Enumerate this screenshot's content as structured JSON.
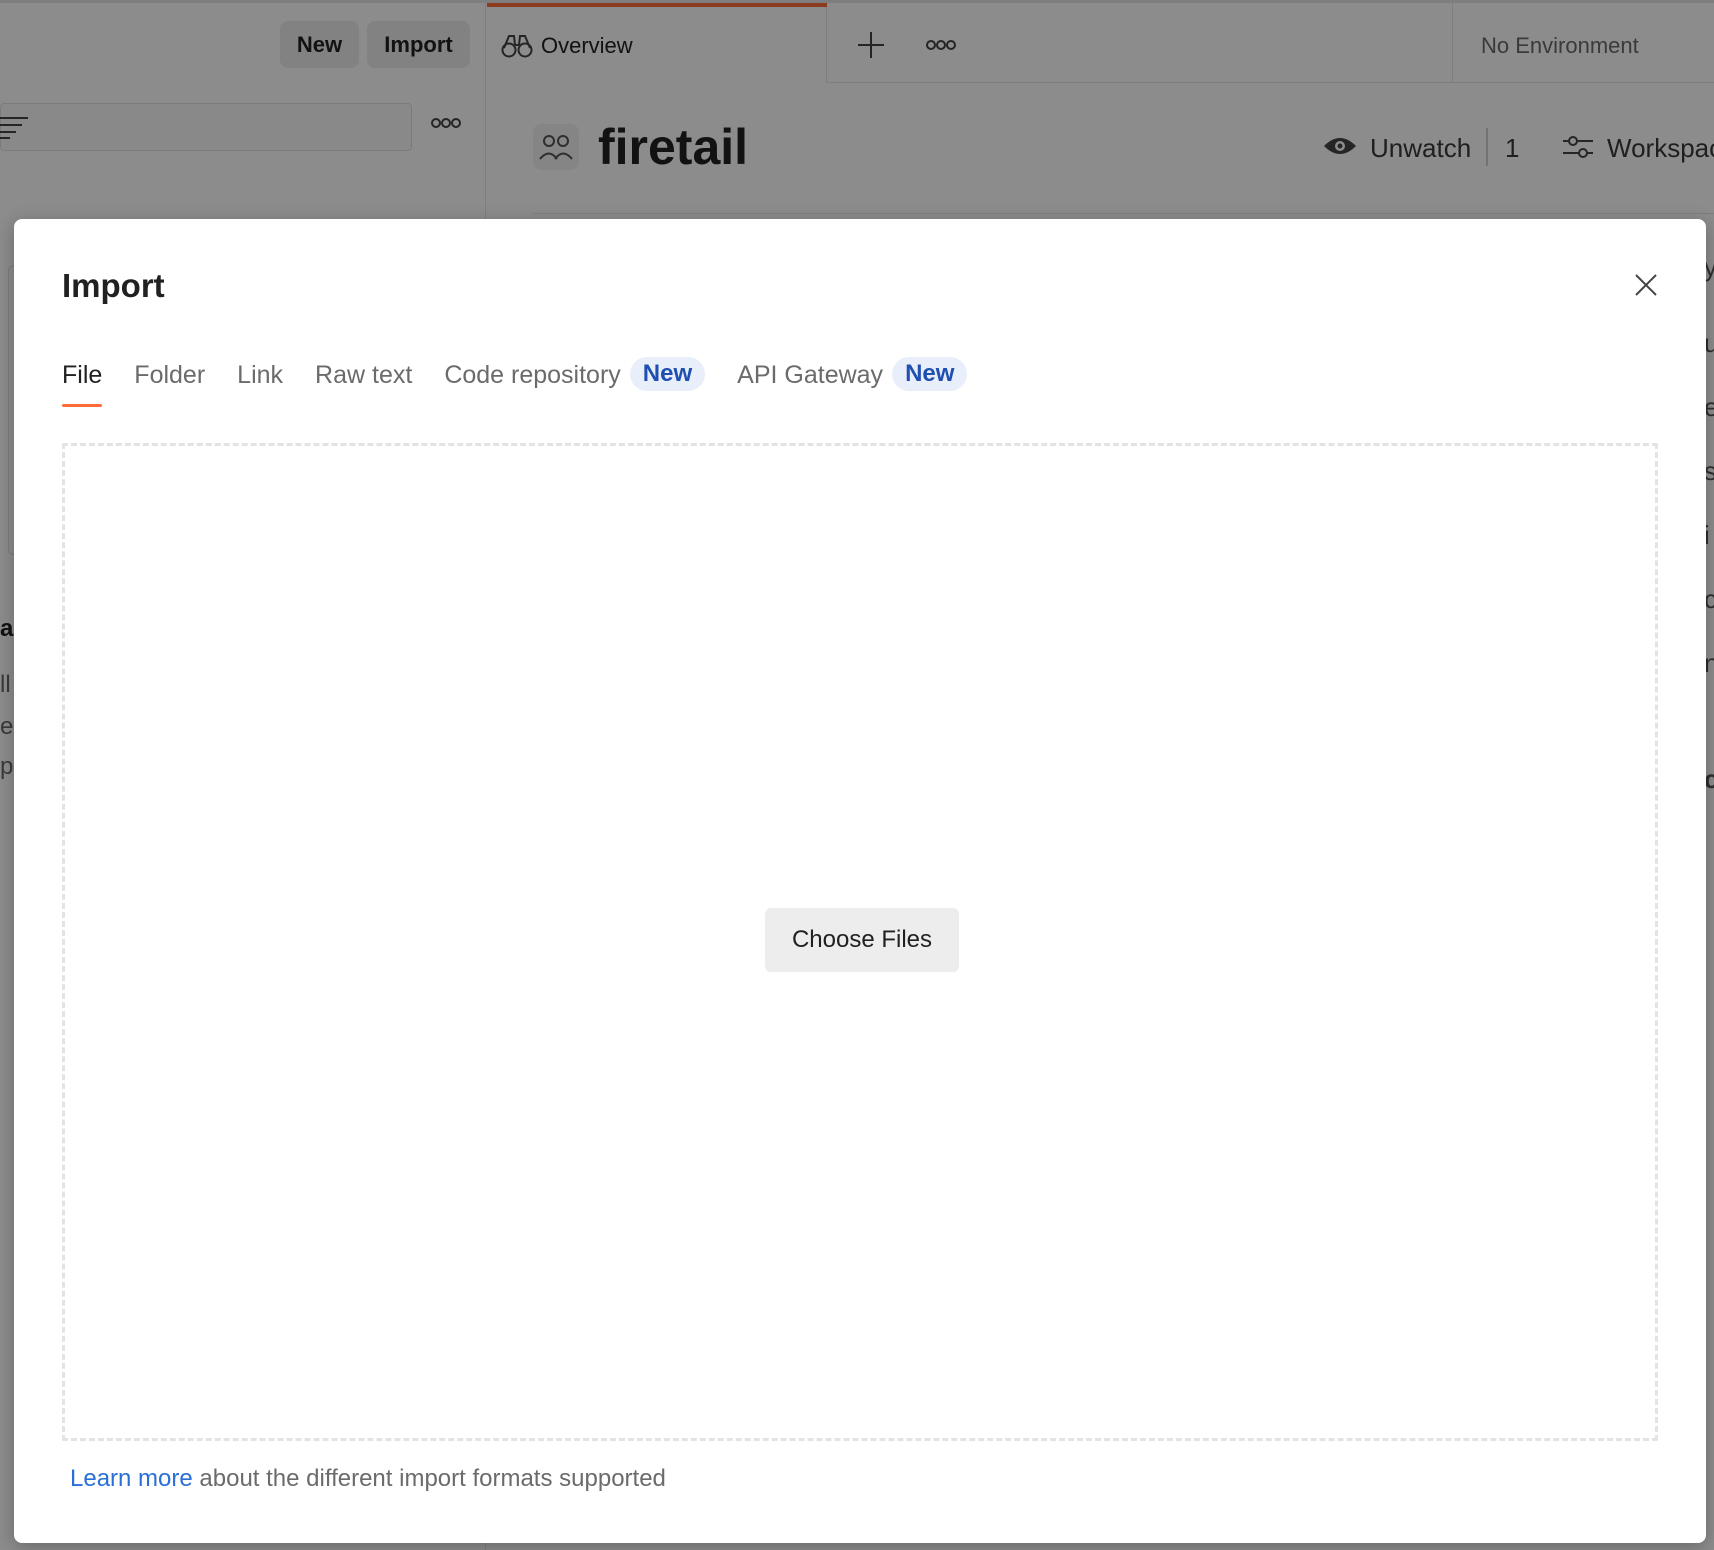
{
  "left_header": {
    "new_label": "New",
    "import_label": "Import"
  },
  "left_fragments": [
    "a",
    "ll",
    "e",
    "p"
  ],
  "tabs_bar": {
    "overview_label": "Overview",
    "environment_label": "No Environment"
  },
  "workspace": {
    "title": "firetail",
    "unwatch_label": "Unwatch",
    "watch_count": "1",
    "settings_label": "Workspac"
  },
  "right_fragments": [
    "y",
    "u",
    "e",
    "s",
    "i",
    "c",
    "n",
    "c"
  ],
  "modal": {
    "title": "Import",
    "tabs": [
      {
        "label": "File",
        "badge": ""
      },
      {
        "label": "Folder",
        "badge": ""
      },
      {
        "label": "Link",
        "badge": ""
      },
      {
        "label": "Raw text",
        "badge": ""
      },
      {
        "label": "Code repository",
        "badge": "New"
      },
      {
        "label": "API Gateway",
        "badge": "New"
      }
    ],
    "choose_files_label": "Choose Files",
    "footer": {
      "link_text": "Learn more",
      "rest_text": " about the different import formats supported"
    }
  },
  "colors": {
    "accent": "#ff6c37",
    "link": "#2a6fd6",
    "badge_text": "#1f4fb0",
    "badge_bg": "#e8effa"
  }
}
